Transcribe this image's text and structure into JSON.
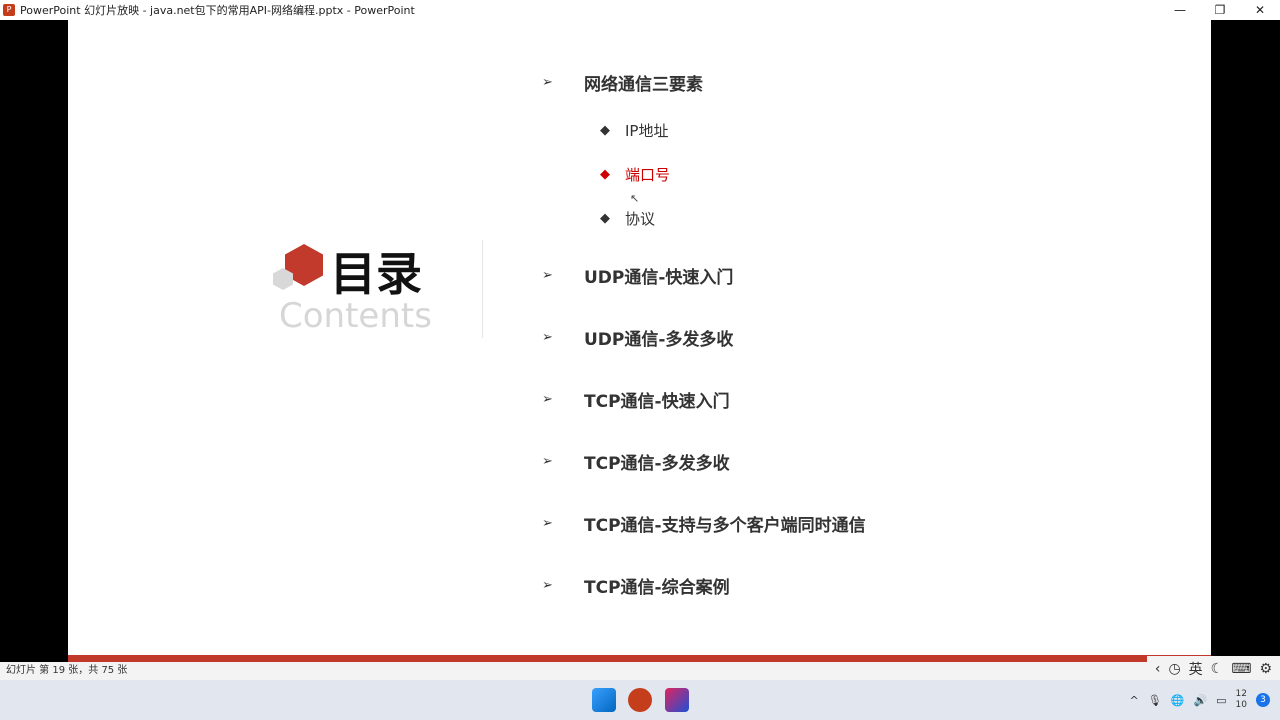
{
  "window": {
    "title": "PowerPoint 幻灯片放映  -  java.net包下的常用API-网络编程.pptx - PowerPoint",
    "app_icon": "P",
    "minimize": "—",
    "restore": "❐",
    "close": "✕"
  },
  "slide": {
    "heading": "目录",
    "subheading": "Contents",
    "items": [
      {
        "label": "网络通信三要素",
        "sub": [
          {
            "label": "IP地址",
            "active": false
          },
          {
            "label": "端口号",
            "active": true
          },
          {
            "label": "协议",
            "active": false
          }
        ]
      },
      {
        "label": "UDP通信-快速入门"
      },
      {
        "label": "UDP通信-多发多收"
      },
      {
        "label": "TCP通信-快速入门"
      },
      {
        "label": "TCP通信-多发多收"
      },
      {
        "label": "TCP通信-支持与多个客户端同时通信"
      },
      {
        "label": "TCP通信-综合案例"
      }
    ],
    "arrow": "➢",
    "diamond": "◆",
    "accent": "#c0392b"
  },
  "status": {
    "slide_info": "幻灯片 第 19 张，共 75 张"
  },
  "ime": {
    "lang": "英"
  },
  "taskbar": {
    "clock_top": "12",
    "clock_bottom": "10",
    "notifications": "3"
  }
}
